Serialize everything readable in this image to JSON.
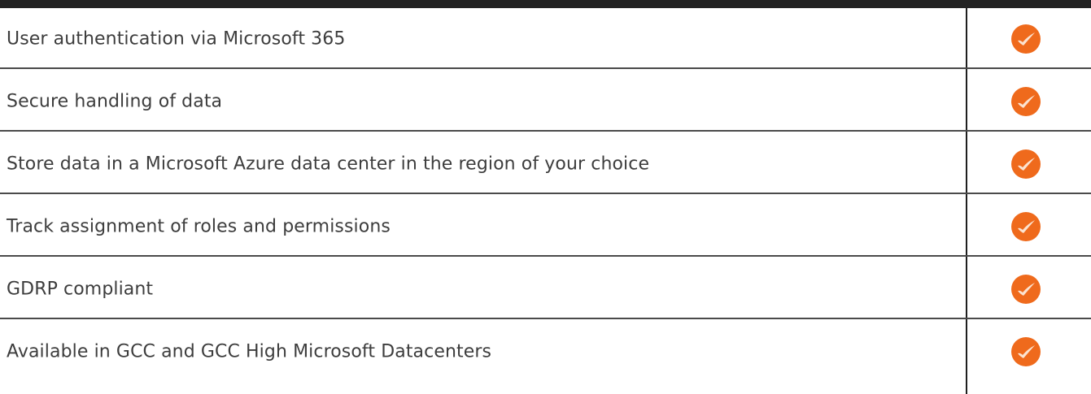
{
  "features": [
    {
      "label": "User authentication via Microsoft 365",
      "included": true,
      "icon": "check-icon"
    },
    {
      "label": "Secure handling of data",
      "included": true,
      "icon": "check-icon"
    },
    {
      "label": "Store data in a Microsoft Azure data center in the region of your choice",
      "included": true,
      "icon": "check-icon"
    },
    {
      "label": "Track assignment of roles and permissions",
      "included": true,
      "icon": "check-icon"
    },
    {
      "label": "GDRP compliant",
      "included": true,
      "icon": "check-icon"
    },
    {
      "label": "Available in GCC and GCC High Microsoft Datacenters",
      "included": true,
      "icon": "check-icon"
    }
  ],
  "colors": {
    "accent": "#ef6a1c",
    "text": "#3d3d3d",
    "rule": "#222222"
  }
}
